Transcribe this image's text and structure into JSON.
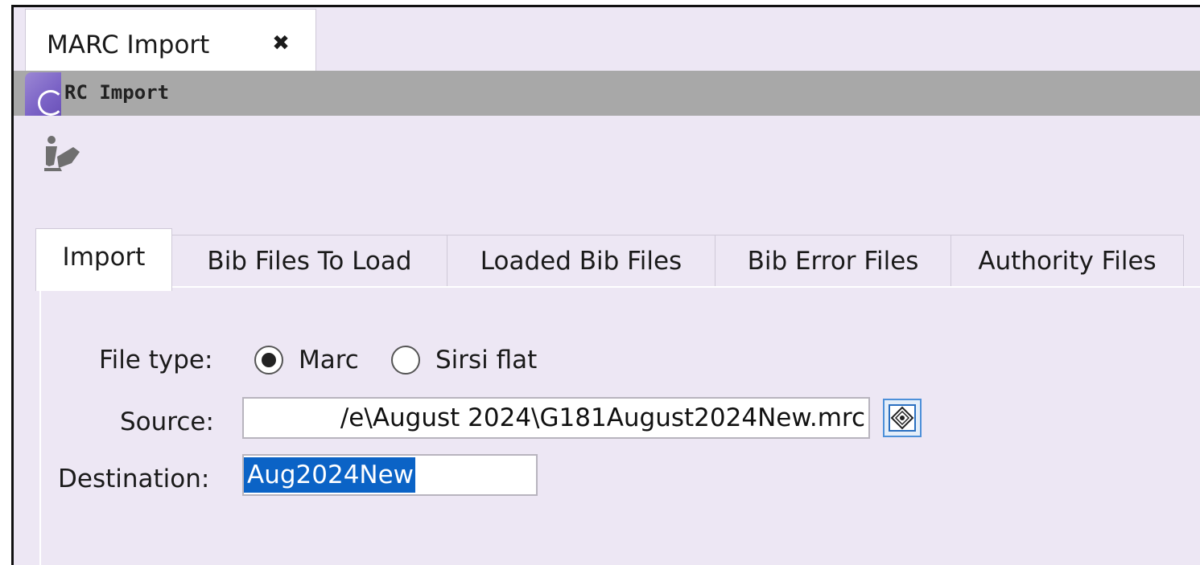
{
  "document_tab": {
    "label": "MARC Import",
    "close_glyph": "✖"
  },
  "title_bar": {
    "text": "RC Import",
    "icon": "marc-import-app-icon"
  },
  "toolbar": {
    "icon": "marc-import-action-icon"
  },
  "tabs": [
    {
      "label": "Import",
      "active": true
    },
    {
      "label": "Bib Files To Load",
      "active": false
    },
    {
      "label": "Loaded Bib Files",
      "active": false
    },
    {
      "label": "Bib Error Files",
      "active": false
    },
    {
      "label": "Authority Files",
      "active": false
    }
  ],
  "form": {
    "file_type_label": "File type:",
    "file_type_options": [
      {
        "label": "Marc",
        "selected": true
      },
      {
        "label": "Sirsi flat",
        "selected": false
      }
    ],
    "source_label": "Source:",
    "source_value": "/e\\August 2024\\G181August2024New.mrc",
    "browse_icon": "browse-file-icon",
    "destination_label": "Destination:",
    "destination_value": "Aug2024New"
  },
  "colors": {
    "background": "#ede7f4",
    "title_bar": "#a8a8a8",
    "selection": "#0b63c6",
    "app_icon": "#7b63c6"
  }
}
